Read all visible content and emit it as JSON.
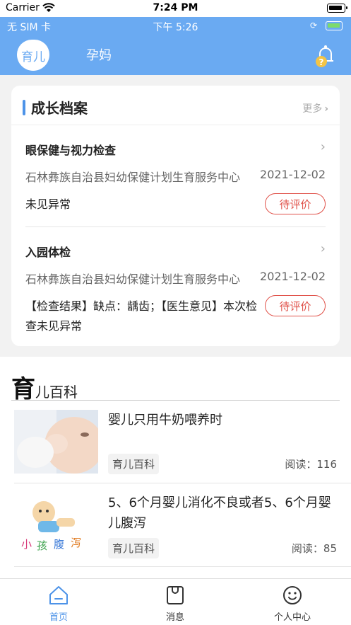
{
  "ios_status": {
    "carrier": "Carrier",
    "time": "7:24 PM"
  },
  "app_status": {
    "network": "无 SIM 卡",
    "time": "下午 5:26"
  },
  "header": {
    "tab_active": "育儿",
    "tab_other": "孕妈"
  },
  "growth": {
    "title": "成长档案",
    "more": "更多",
    "records": [
      {
        "name": "眼保健与视力检查",
        "org": "石林彝族自治县妇幼保健计划生育服务中心",
        "date": "2021-12-02",
        "result": "未见异常",
        "action": "待评价"
      },
      {
        "name": "入园体检",
        "org": "石林彝族自治县妇幼保健计划生育服务中心",
        "date": "2021-12-02",
        "result": "【检查结果】缺点：龋齿；【医生意见】本次检查未见异常",
        "action": "待评价"
      }
    ]
  },
  "wiki": {
    "title_big": "育",
    "title_small": "儿百科",
    "articles": [
      {
        "headline": "婴儿只用牛奶喂养时",
        "tag": "育儿百科",
        "reads": "阅读：116"
      },
      {
        "headline": "5、6个月婴儿消化不良或者5、6个月婴儿腹泻",
        "tag": "育儿百科",
        "reads": "阅读：85"
      }
    ]
  },
  "tabbar": {
    "home": "首页",
    "messages": "消息",
    "profile": "个人中心"
  },
  "colors": {
    "primary": "#6aaaf2",
    "accent": "#4d93e8",
    "rate": "#e0524a"
  }
}
